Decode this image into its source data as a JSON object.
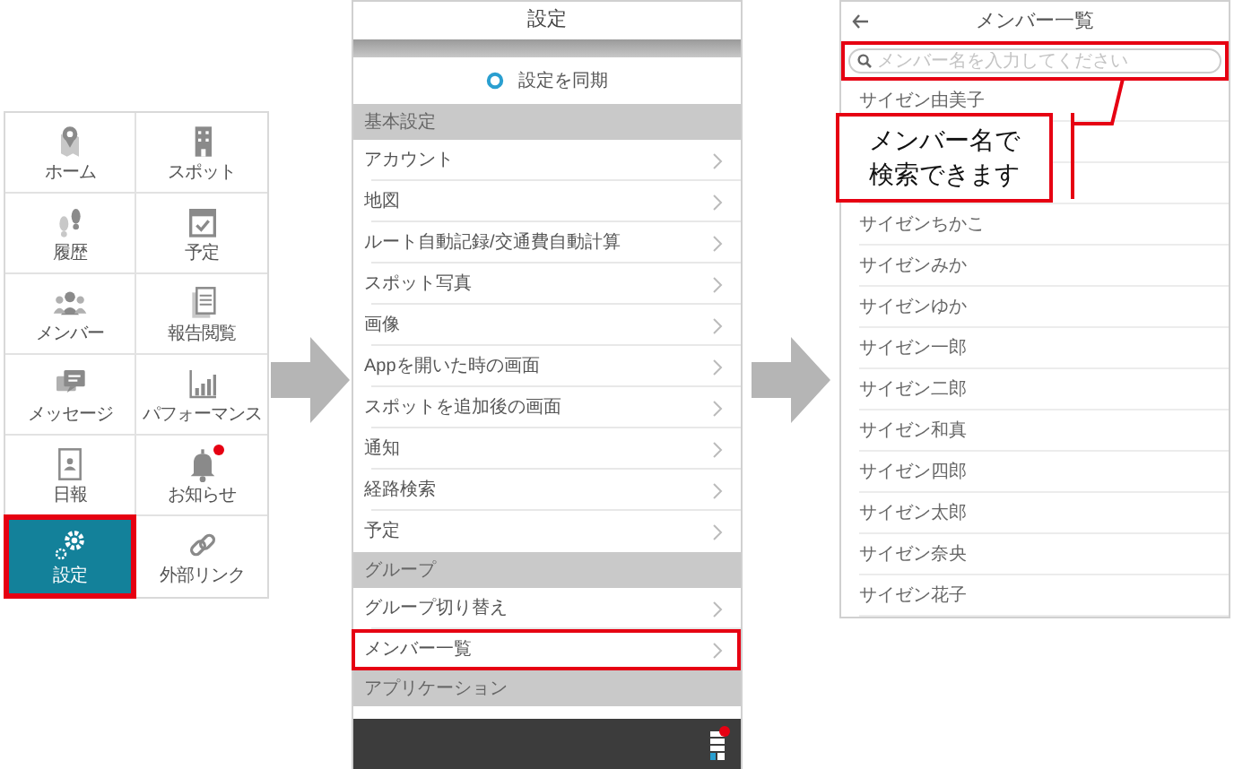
{
  "nav_grid": {
    "items": [
      {
        "label": "ホーム",
        "selected": false,
        "badge": false,
        "highlighted": false
      },
      {
        "label": "スポット",
        "selected": false,
        "badge": false,
        "highlighted": false
      },
      {
        "label": "履歴",
        "selected": false,
        "badge": false,
        "highlighted": false
      },
      {
        "label": "予定",
        "selected": false,
        "badge": false,
        "highlighted": false
      },
      {
        "label": "メンバー",
        "selected": false,
        "badge": false,
        "highlighted": false
      },
      {
        "label": "報告閲覧",
        "selected": false,
        "badge": false,
        "highlighted": false
      },
      {
        "label": "メッセージ",
        "selected": false,
        "badge": false,
        "highlighted": false
      },
      {
        "label": "パフォーマンス",
        "selected": false,
        "badge": false,
        "highlighted": false
      },
      {
        "label": "日報",
        "selected": false,
        "badge": false,
        "highlighted": false
      },
      {
        "label": "お知らせ",
        "selected": false,
        "badge": true,
        "highlighted": false
      },
      {
        "label": "設定",
        "selected": true,
        "badge": false,
        "highlighted": true
      },
      {
        "label": "外部リンク",
        "selected": false,
        "badge": false,
        "highlighted": false
      }
    ]
  },
  "settings_screen": {
    "title": "設定",
    "sync_label": "設定を同期",
    "sections": [
      {
        "title": "基本設定",
        "items": [
          {
            "label": "アカウント",
            "highlighted": false
          },
          {
            "label": "地図",
            "highlighted": false
          },
          {
            "label": "ルート自動記録/交通費自動計算",
            "highlighted": false
          },
          {
            "label": "スポット写真",
            "highlighted": false
          },
          {
            "label": "画像",
            "highlighted": false
          },
          {
            "label": "Appを開いた時の画面",
            "highlighted": false
          },
          {
            "label": "スポットを追加後の画面",
            "highlighted": false
          },
          {
            "label": "通知",
            "highlighted": false
          },
          {
            "label": "経路検索",
            "highlighted": false
          },
          {
            "label": "予定",
            "highlighted": false
          }
        ]
      },
      {
        "title": "グループ",
        "items": [
          {
            "label": "グループ切り替え",
            "highlighted": false
          },
          {
            "label": "メンバー一覧",
            "highlighted": true
          }
        ]
      },
      {
        "title": "アプリケーション"
      }
    ]
  },
  "members_screen": {
    "title": "メンバー一覧",
    "search": {
      "placeholder": "メンバー名を入力してください",
      "highlighted": true
    },
    "members": [
      "サイゼン由美子",
      "サイゼンちかこ",
      "サイゼンみか",
      "サイゼンゆか",
      "サイゼン一郎",
      "サイゼン二郎",
      "サイゼン和真",
      "サイゼン四郎",
      "サイゼン太郎",
      "サイゼン奈央",
      "サイゼン花子"
    ]
  },
  "callout": {
    "text": "メンバー名で検索できます"
  }
}
